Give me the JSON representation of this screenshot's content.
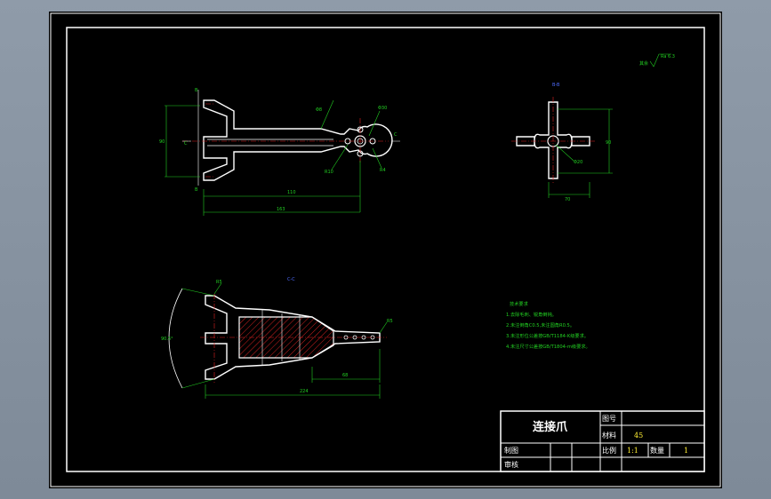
{
  "section_labels": {
    "view_top_right": "B-B",
    "view_bottom": "C-C"
  },
  "roughness": {
    "symbol": "其余",
    "value": "Ra 6.3"
  },
  "top_view": {
    "marks": {
      "b_top": "B",
      "b_bottom": "B",
      "c_left": "C",
      "c_right": "C"
    },
    "dims": {
      "overall_height": "90",
      "inner_length": "110",
      "overall_length": "163",
      "hole_small": "Φ8",
      "hole_big": "Φ30",
      "slot_r": "R4",
      "r_big": "R10"
    }
  },
  "side_view": {
    "dims": {
      "width": "70",
      "height": "90",
      "hole": "Φ20"
    }
  },
  "bottom_view": {
    "dims": {
      "angle": "90.5°",
      "r_tip": "R5",
      "length_a": "68",
      "length_b": "224",
      "r_end": "R5"
    }
  },
  "tech_notes": {
    "title": "技术要求",
    "lines": [
      "1.去除毛刺、锐角倒钝。",
      "2.未注倒角C0.5,未注圆角R0.5。",
      "3.未注形位公差按GB/T1184-K级要求。",
      "4.未注尺寸公差按GB/T1804-m级要求。"
    ]
  },
  "title_block": {
    "part_name": "连接爪",
    "drawing_no_label": "图号",
    "material_label": "材料",
    "material_value": "45",
    "drawn_label": "制图",
    "review_label": "审核",
    "scale_label": "比例",
    "scale_value": "1:1",
    "qty_label": "数量",
    "qty_value": "1"
  }
}
